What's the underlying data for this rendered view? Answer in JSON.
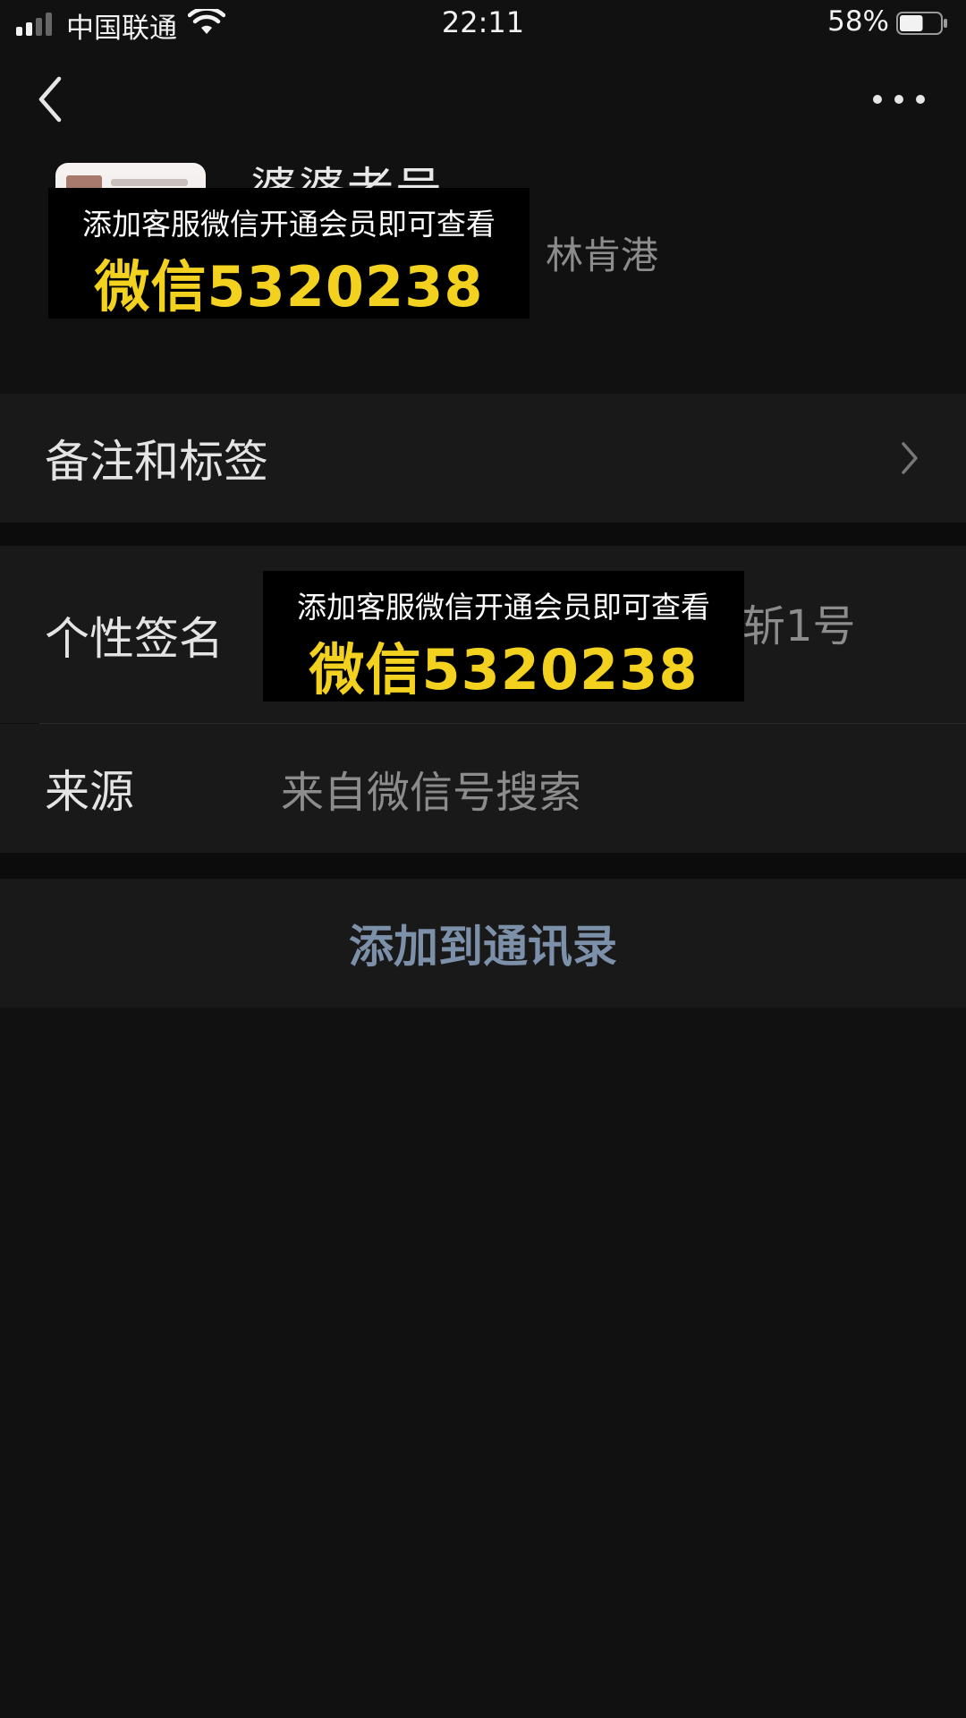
{
  "status_bar": {
    "carrier": "中国联通",
    "time": "22:11",
    "battery_percent": "58%",
    "battery_level": 0.58
  },
  "nav": {
    "back_icon": "chevron-left-icon",
    "more_icon": "more-horizontal-icon"
  },
  "profile": {
    "name": "婆婆老号",
    "region": "林肯港"
  },
  "rows": {
    "remarks_label": "备注和标签",
    "signature_label": "个性签名",
    "signature_value": "斩1号",
    "source_label": "来源",
    "source_value": "来自微信号搜索"
  },
  "actions": {
    "add_contact": "添加到通讯录"
  },
  "overlays": [
    {
      "line1": "添加客服微信开通会员即可查看",
      "line2": "微信5320238"
    },
    {
      "line1": "添加客服微信开通会员即可查看",
      "line2": "微信5320238"
    }
  ],
  "colors": {
    "background": "#111111",
    "accent_link": "#7d90aa",
    "overlay_highlight": "#f3d11f"
  }
}
